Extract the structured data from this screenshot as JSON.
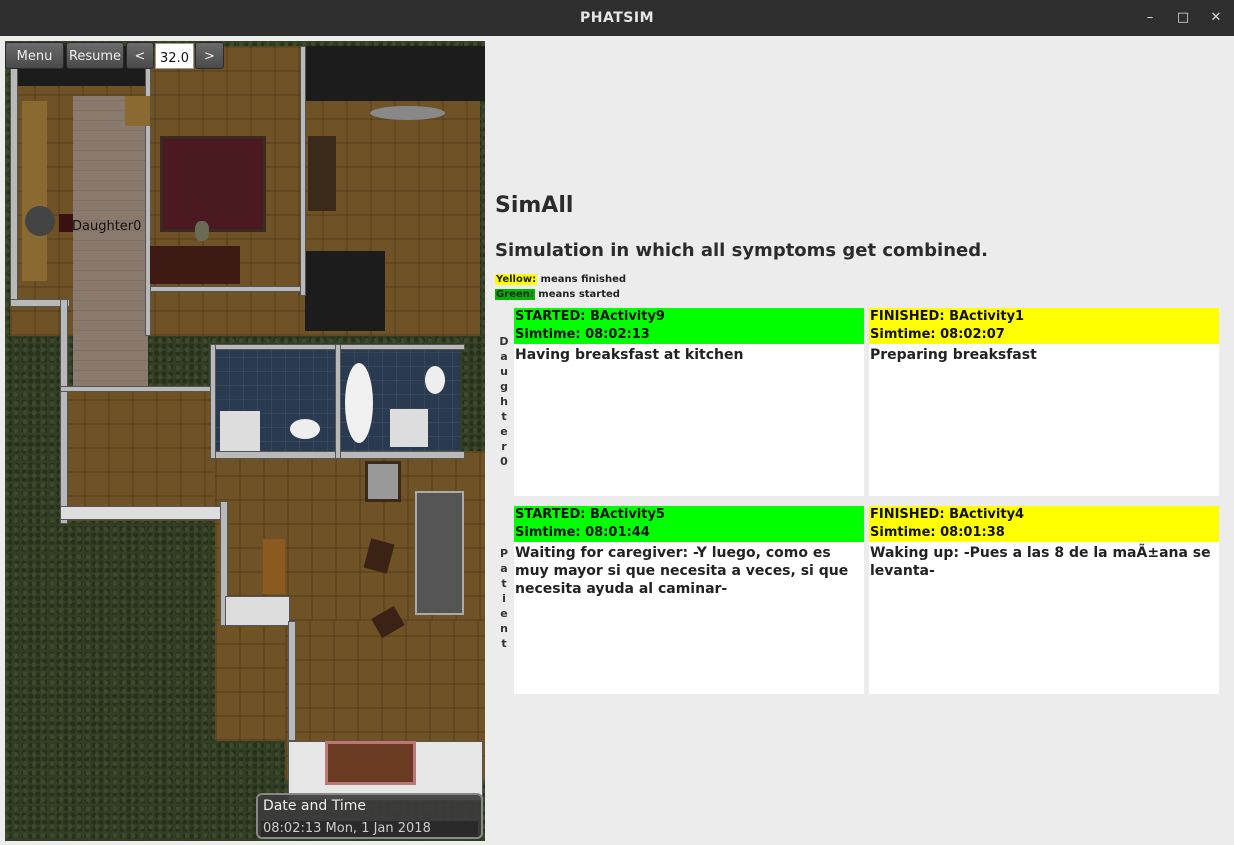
{
  "window": {
    "title": "PHATSIM",
    "minimize_glyph": "–",
    "maximize_glyph": "□",
    "close_glyph": "✕"
  },
  "controls": {
    "menu_label": "Menu",
    "resume_label": "Resume",
    "prev_label": "<",
    "speed_value": "32.0",
    "next_label": ">"
  },
  "scene": {
    "agent_label": "Daughter0"
  },
  "datetime": {
    "heading": "Date and Time",
    "value": "08:02:13 Mon, 1 Jan 2018"
  },
  "simulation": {
    "title": "SimAll",
    "description": "Simulation in which all symptoms get combined."
  },
  "legend": {
    "yellow_word": "Yellow:",
    "yellow_text": " means finished",
    "green_word": "Green:",
    "green_text": " means started",
    "yellow_color": "#ffff00",
    "green_color": "#00ff00"
  },
  "actors": [
    {
      "name": "Daughter0",
      "letters": [
        "D",
        "a",
        "u",
        "g",
        "h",
        "t",
        "e",
        "r",
        "0"
      ],
      "activities": [
        {
          "status": "STARTED: BActivity9",
          "simtime": "Simtime:   08:02:13",
          "description": "Having breaksfast at kitchen",
          "color": "#00ff00"
        },
        {
          "status": "FINISHED: BActivity1",
          "simtime": "Simtime:   08:02:07",
          "description": "Preparing breaksfast",
          "color": "#ffff00"
        }
      ]
    },
    {
      "name": "Patient",
      "letters": [
        "P",
        "a",
        "t",
        "i",
        "e",
        "n",
        "t"
      ],
      "activities": [
        {
          "status": "STARTED: BActivity5",
          "simtime": "Simtime:   08:01:44",
          "description": "Waiting for caregiver: -Y luego, como es muy mayor si que necesita a veces, si que necesita ayuda al caminar-",
          "color": "#00ff00"
        },
        {
          "status": "FINISHED: BActivity4",
          "simtime": "Simtime:   08:01:38",
          "description": "Waking up: -Pues a las 8 de la maÃ±ana se levanta-",
          "color": "#ffff00"
        }
      ]
    }
  ]
}
